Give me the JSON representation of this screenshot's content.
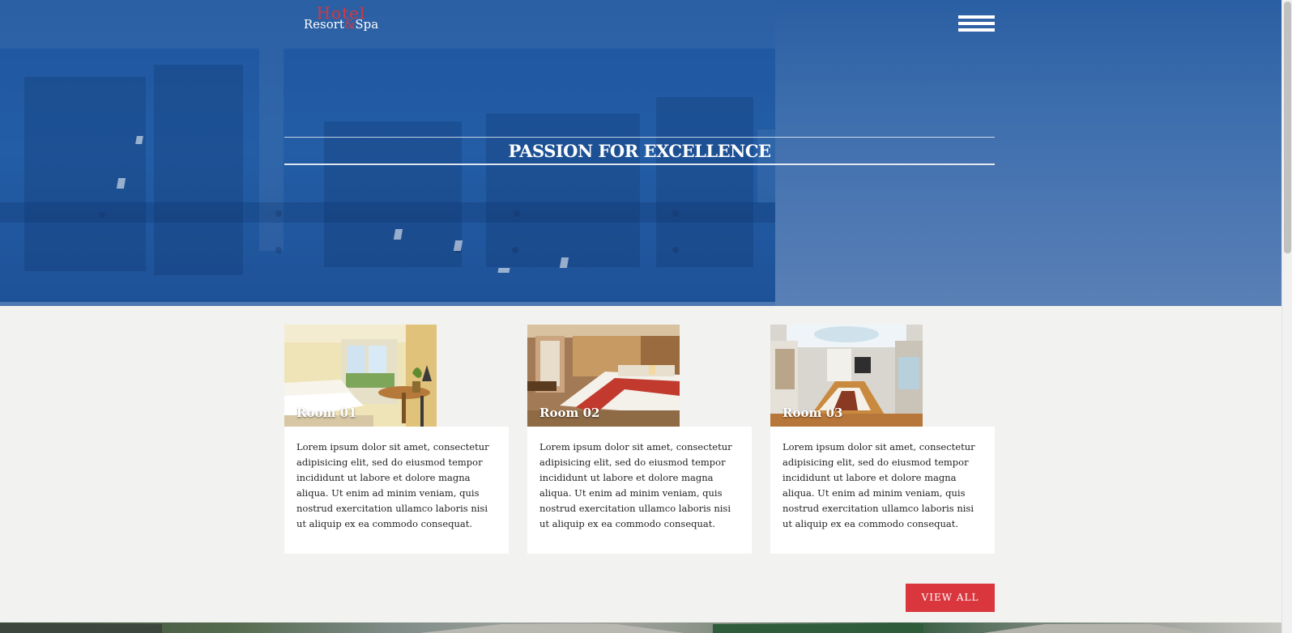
{
  "brand": {
    "logo_top": "Hotel",
    "logo_bottom_left": "Resort",
    "logo_amp": "&",
    "logo_bottom_right": "Spa",
    "accent_color": "#d9363e",
    "hero_color": "#2a5fa3"
  },
  "header": {
    "menu_icon": "hamburger-icon"
  },
  "hero": {
    "tagline": "PASSION FOR EXCELLENCE"
  },
  "rooms": [
    {
      "title": "Room 01",
      "description": "Lorem ipsum dolor sit amet, consectetur adipisicing elit, sed do eiusmod tempor incididunt ut labore et dolore magna aliqua. Ut enim ad minim veniam, quis nostrud exercitation ullamco laboris nisi ut aliquip ex ea commodo consequat."
    },
    {
      "title": "Room 02",
      "description": "Lorem ipsum dolor sit amet, consectetur adipisicing elit, sed do eiusmod tempor incididunt ut labore et dolore magna aliqua. Ut enim ad minim veniam, quis nostrud exercitation ullamco laboris nisi ut aliquip ex ea commodo consequat."
    },
    {
      "title": "Room 03",
      "description": "Lorem ipsum dolor sit amet, consectetur adipisicing elit, sed do eiusmod tempor incididunt ut labore et dolore magna aliqua. Ut enim ad minim veniam, quis nostrud exercitation ullamco laboris nisi ut aliquip ex ea commodo consequat."
    }
  ],
  "actions": {
    "view_all_label": "VIEW ALL"
  }
}
